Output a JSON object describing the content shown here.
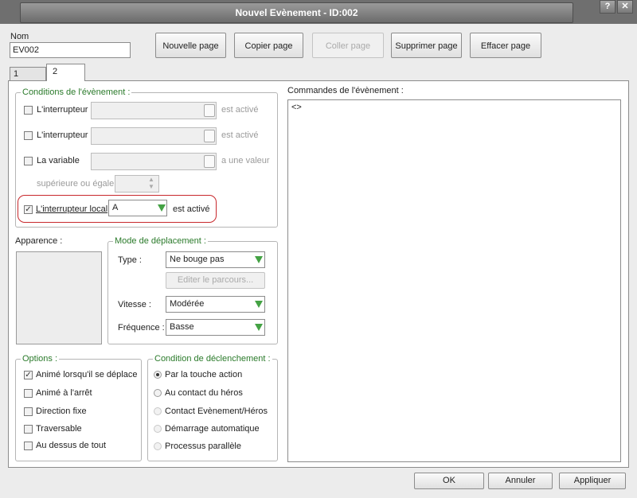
{
  "window": {
    "title": "Nouvel Evènement - ID:002",
    "help_glyph": "?",
    "close_glyph": "✕"
  },
  "name": {
    "label": "Nom",
    "value": "EV002"
  },
  "toolbar": {
    "new_page": "Nouvelle page",
    "copy_page": "Copier page",
    "paste_page": "Coller page",
    "delete_page": "Supprimer page",
    "clear_page": "Effacer page"
  },
  "tabs": [
    {
      "label": "1",
      "active": false
    },
    {
      "label": "2",
      "active": true
    }
  ],
  "conditions": {
    "legend": "Conditions de l'évènement :",
    "switch1": {
      "label": "L'interrupteur",
      "suffix": "est activé",
      "checked": false
    },
    "switch2": {
      "label": "L'interrupteur",
      "suffix": "est activé",
      "checked": false
    },
    "variable": {
      "label": "La variable",
      "suffix": "a une valeur",
      "checked": false,
      "compare_label": "supérieure ou égale"
    },
    "local_switch": {
      "label": "L'interrupteur local",
      "value": "A",
      "suffix": "est activé",
      "checked": true,
      "highlight_color": "#c8282c"
    }
  },
  "appearance": {
    "label": "Apparence :"
  },
  "movement": {
    "legend": "Mode de déplacement :",
    "type_label": "Type :",
    "type_value": "Ne bouge pas",
    "edit_route": "Editer le parcours...",
    "speed_label": "Vitesse :",
    "speed_value": "Modérée",
    "freq_label": "Fréquence :",
    "freq_value": "Basse"
  },
  "options": {
    "legend": "Options :",
    "items": [
      {
        "label": "Animé lorsqu'il se déplace",
        "checked": true
      },
      {
        "label": "Animé à l'arrêt",
        "checked": false
      },
      {
        "label": "Direction fixe",
        "checked": false
      },
      {
        "label": "Traversable",
        "checked": false
      },
      {
        "label": "Au dessus de tout",
        "checked": false
      }
    ]
  },
  "trigger": {
    "legend": "Condition de déclenchement :",
    "items": [
      {
        "label": "Par la touche action",
        "selected": true
      },
      {
        "label": "Au contact du héros",
        "selected": false
      },
      {
        "label": "Contact Evènement/Héros",
        "selected": false
      },
      {
        "label": "Démarrage automatique",
        "selected": false
      },
      {
        "label": "Processus parallèle",
        "selected": false
      }
    ]
  },
  "commands": {
    "label": "Commandes de l'évènement :",
    "first_line": "<>"
  },
  "footer": {
    "ok": "OK",
    "cancel": "Annuler",
    "apply": "Appliquer"
  },
  "colors": {
    "accent_green": "#2a7a2a",
    "arrow_green": "#44a244"
  }
}
